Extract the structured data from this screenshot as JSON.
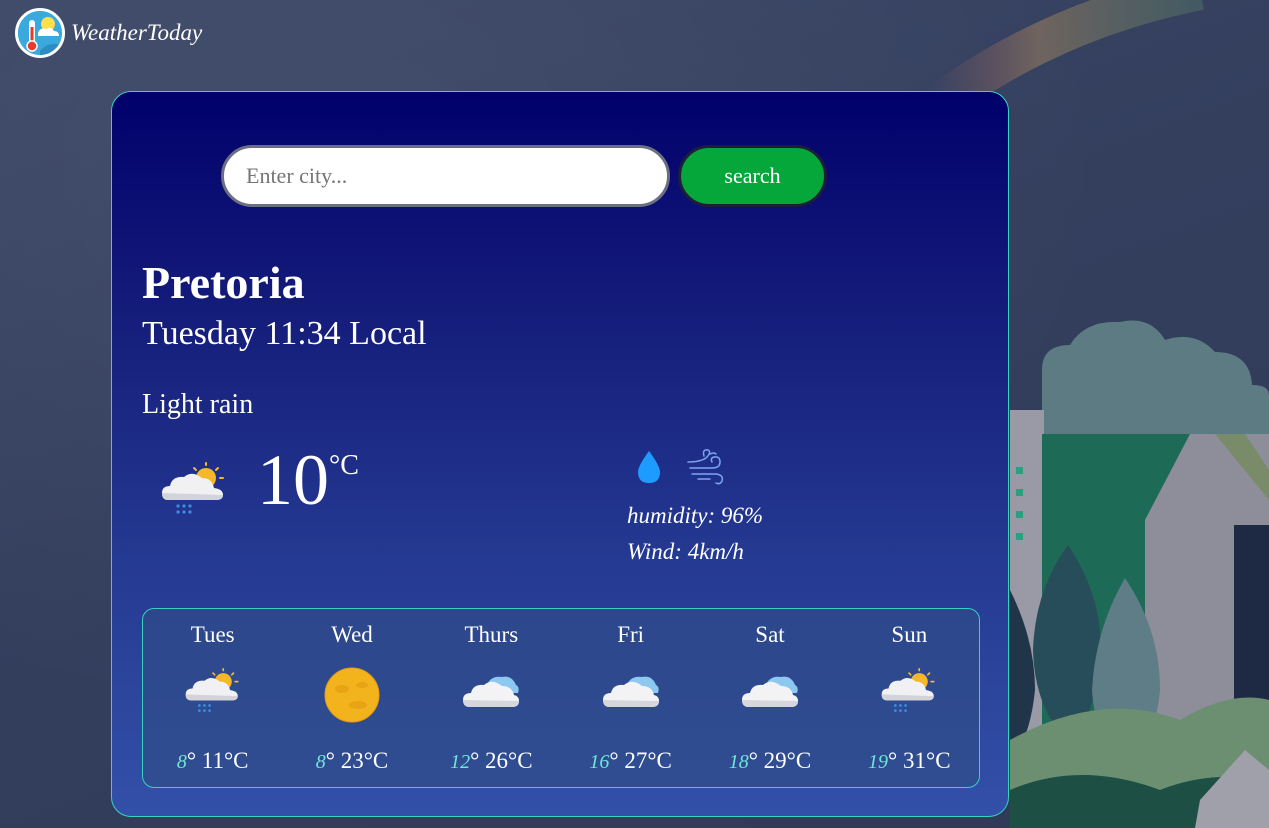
{
  "brand": {
    "name": "WeatherToday",
    "logo_icon": "thermometer-sun-logo-icon"
  },
  "search": {
    "placeholder": "Enter city...",
    "value": "",
    "button_label": "search"
  },
  "current": {
    "city": "Pretoria",
    "datetime": "Tuesday 11:34 Local",
    "condition": "Light rain",
    "icon": "rain-cloud-sun-icon",
    "temperature": "10",
    "unit": "°C",
    "humidity_icon": "water-drop-icon",
    "wind_icon": "wind-icon",
    "humidity": "humidity: 96%",
    "wind": "Wind: 4km/h"
  },
  "forecast": [
    {
      "day": "Tues",
      "icon": "rain-cloud-sun-icon",
      "min": "8",
      "max": "11°C"
    },
    {
      "day": "Wed",
      "icon": "sun-icon",
      "min": "8",
      "max": "23°C"
    },
    {
      "day": "Thurs",
      "icon": "cloud-icon",
      "min": "12",
      "max": "26°C"
    },
    {
      "day": "Fri",
      "icon": "cloud-icon",
      "min": "16",
      "max": "27°C"
    },
    {
      "day": "Sat",
      "icon": "cloud-icon",
      "min": "18",
      "max": "29°C"
    },
    {
      "day": "Sun",
      "icon": "rain-cloud-sun-icon",
      "min": "19",
      "max": "31°C"
    }
  ],
  "colors": {
    "accent_border": "#37d2c0",
    "search_button": "#05a73b",
    "min_temp": "#6ee7d6",
    "card_top": "#01006b",
    "card_bottom": "#3350a8"
  }
}
